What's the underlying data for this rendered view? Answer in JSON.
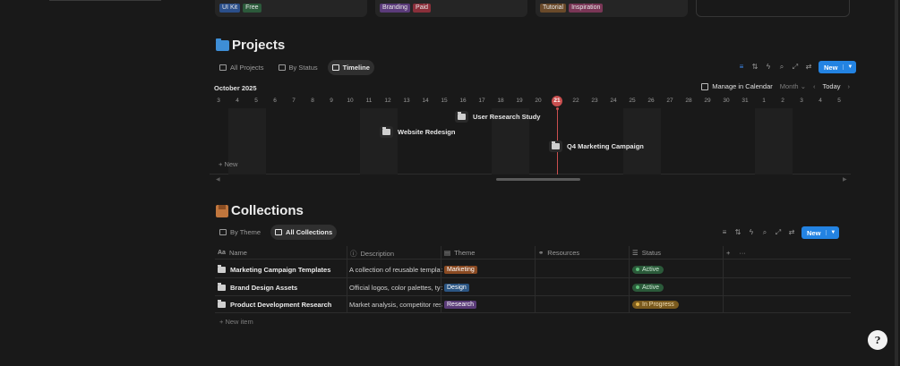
{
  "top_cards": [
    {
      "tags": [
        {
          "text": "UI Kit",
          "color": "#2b4f8a"
        },
        {
          "text": "Free",
          "color": "#2c5a3b"
        }
      ]
    },
    {
      "tags": [
        {
          "text": "Branding",
          "color": "#5b3b7a"
        },
        {
          "text": "Paid",
          "color": "#8a2f3a"
        }
      ]
    },
    {
      "tags": [
        {
          "text": "Tutorial",
          "color": "#6a4a2a"
        },
        {
          "text": "Inspiration",
          "color": "#7a3656"
        }
      ]
    }
  ],
  "projects": {
    "title": "Projects",
    "tabs": [
      {
        "label": "All Projects",
        "active": false
      },
      {
        "label": "By Status",
        "active": false
      },
      {
        "label": "Timeline",
        "active": true
      }
    ],
    "new_label": "New"
  },
  "timeline": {
    "month": "October 2025",
    "manage": "Manage in Calendar",
    "scale": "Month",
    "today_label": "Today",
    "days": [
      "3",
      "4",
      "5",
      "6",
      "7",
      "8",
      "9",
      "10",
      "11",
      "12",
      "13",
      "14",
      "15",
      "16",
      "17",
      "18",
      "19",
      "20",
      "21",
      "22",
      "23",
      "24",
      "25",
      "26",
      "27",
      "28",
      "29",
      "30",
      "31",
      "1",
      "2",
      "3",
      "4",
      "5"
    ],
    "today": "21",
    "items": [
      {
        "label": "User Research Study"
      },
      {
        "label": "Website Redesign"
      },
      {
        "label": "Q4 Marketing Campaign"
      }
    ],
    "new_label": "New"
  },
  "collections": {
    "title": "Collections",
    "tabs": [
      {
        "label": "By Theme",
        "active": false
      },
      {
        "label": "All Collections",
        "active": true
      }
    ],
    "new_label": "New",
    "columns": [
      "Name",
      "Description",
      "Theme",
      "Resources",
      "Status"
    ],
    "rows": [
      {
        "name": "Marketing Campaign Templates",
        "description": "A collection of reusable templat",
        "theme": "Marketing",
        "theme_color": "#8a4a22",
        "status": "Active",
        "status_color": "#2b5a3a",
        "dot": "#5fbf7a"
      },
      {
        "name": "Brand Design Assets",
        "description": "Official logos, color palettes, typ",
        "theme": "Design",
        "theme_color": "#2b5582",
        "status": "Active",
        "status_color": "#2b5a3a",
        "dot": "#5fbf7a"
      },
      {
        "name": "Product Development Research",
        "description": "Market analysis, competitor res",
        "theme": "Research",
        "theme_color": "#5a3b78",
        "status": "In Progress",
        "status_color": "#7a5a1e",
        "dot": "#e0b34a"
      }
    ],
    "new_item": "New item"
  },
  "help": "?"
}
